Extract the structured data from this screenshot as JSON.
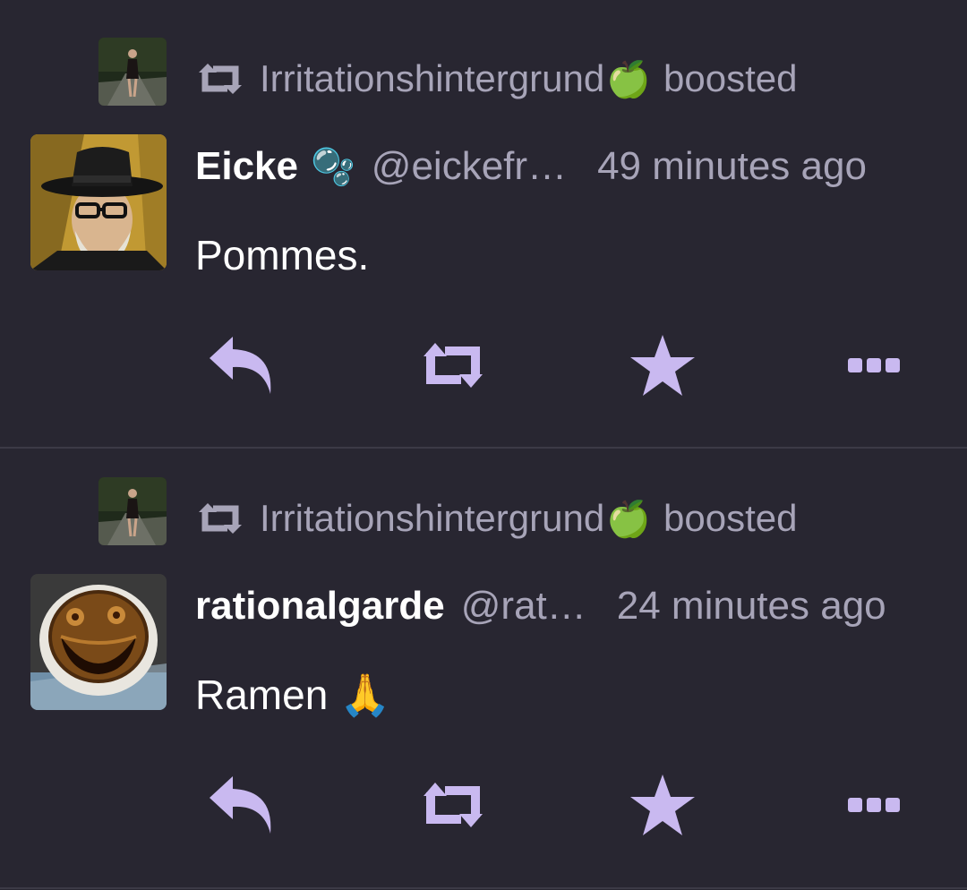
{
  "posts": [
    {
      "boost": {
        "name": "Irritationshintergrund",
        "emoji": "🍏",
        "label": "boosted"
      },
      "author": {
        "display_name": "Eicke",
        "emoji": "🫧",
        "handle": "@eickefr…",
        "time": "49 minutes ago"
      },
      "content": "Pommes.",
      "content_emoji": ""
    },
    {
      "boost": {
        "name": "Irritationshintergrund",
        "emoji": "🍏",
        "label": "boosted"
      },
      "author": {
        "display_name": "rationalgarde",
        "emoji": "",
        "handle": "@rat…",
        "time": "24 minutes ago"
      },
      "content": "Ramen",
      "content_emoji": "🙏"
    }
  ],
  "icons": {
    "boost": "boost-icon",
    "reply": "reply-icon",
    "reblog": "reblog-icon",
    "favourite": "star-icon",
    "more": "more-icon"
  },
  "colors": {
    "background": "#282631",
    "separator": "#3c3a46",
    "accent": "#c9b9f0",
    "muted": "#a7a4b8",
    "text": "#ffffff"
  }
}
